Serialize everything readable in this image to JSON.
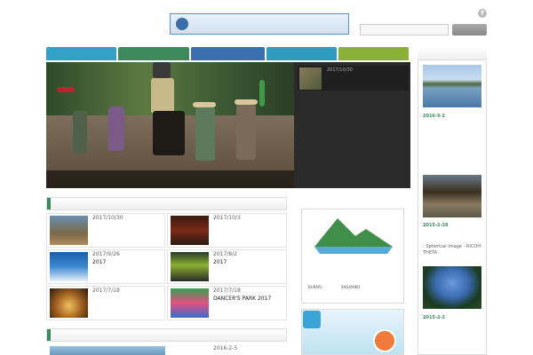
{
  "header": {
    "site_title": "",
    "tagline": "",
    "banner_text": "",
    "top_links": [
      "",
      ""
    ],
    "facebook_label": "f",
    "search_placeholder": "",
    "search_button": ""
  },
  "nav": {
    "items": [
      {
        "label": "",
        "color": "#33a0c6"
      },
      {
        "label": "",
        "color": "#3e8a5c"
      },
      {
        "label": "",
        "color": "#3a6fb0"
      },
      {
        "label": "",
        "color": "#2f9bbf"
      },
      {
        "label": "",
        "color": "#8bb038"
      },
      {
        "label": "",
        "color": "#c8464a"
      }
    ]
  },
  "hero": {
    "caption": "",
    "side": {
      "date": "2017/10/30",
      "category": "",
      "title": ""
    }
  },
  "news": {
    "heading": "",
    "more": "",
    "items": [
      {
        "date": "2017/10/30",
        "title": ""
      },
      {
        "date": "2017/10/3",
        "title": ""
      },
      {
        "date": "2017/9/26",
        "title": "2017"
      },
      {
        "date": "2017/8/2",
        "title": "2017"
      },
      {
        "date": "2017/7/18",
        "title": ""
      },
      {
        "date": "2017/7/18",
        "title": "DANCER'S PARK 2017"
      }
    ]
  },
  "section2": {
    "heading": "",
    "more": "",
    "date": "2016-2-5"
  },
  "ad": {
    "heading": "",
    "logo_top": "",
    "logo_main": "",
    "logo_roman_left": "BURARI",
    "logo_roman_right": "SAGAMIKO"
  },
  "ad2": {
    "title": "",
    "text": ""
  },
  "right": {
    "heading": "",
    "posts": [
      {
        "date": "2016-5-2",
        "title": "",
        "text": ""
      },
      {
        "date": "2015-2-28",
        "title": "",
        "text": "- Spherical Image - RICOH THETA"
      },
      {
        "date": "2015-2-2",
        "title": "",
        "text": ""
      }
    ]
  }
}
